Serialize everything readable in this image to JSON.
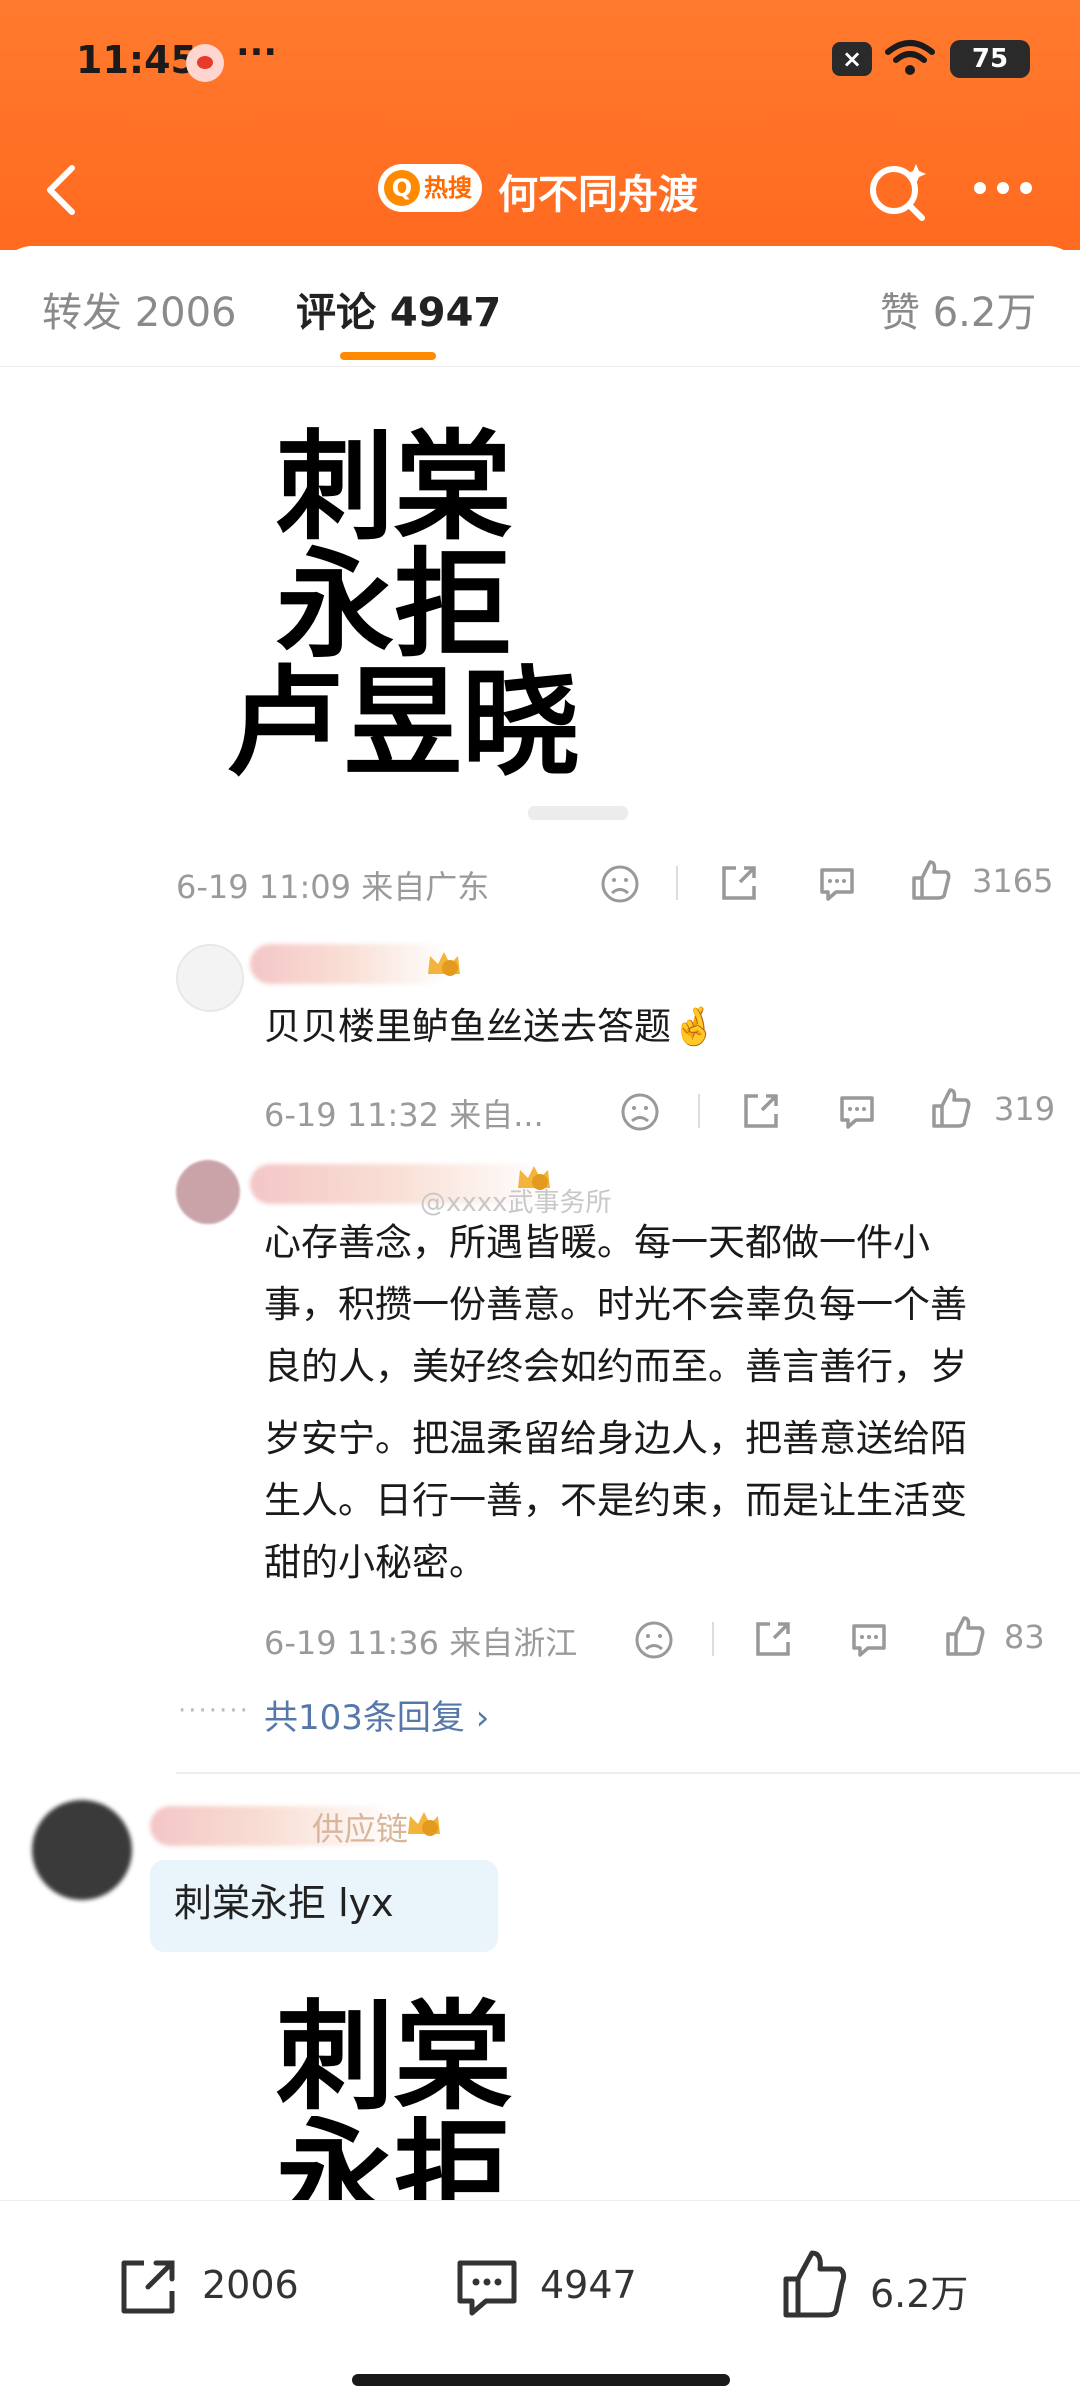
{
  "status_bar": {
    "time": "11:45",
    "dots": "···",
    "battery": "75",
    "x_label": "×"
  },
  "nav": {
    "hot_label": "热搜",
    "title": "何不同舟渡"
  },
  "tabs": [
    {
      "label": "转发 2006"
    },
    {
      "label": "评论 4947"
    },
    {
      "label": "赞 6.2万"
    }
  ],
  "post_image": {
    "line1": "刺棠",
    "line2": "永拒",
    "line3": "卢昱晓"
  },
  "post_meta": {
    "time_loc": "6-19 11:09 来自广东",
    "likes": "3165"
  },
  "comments": [
    {
      "text": "贝贝楼里鲈鱼丝送去答题🤞",
      "time_loc": "6-19 11:32 来自...",
      "likes": "319"
    },
    {
      "text_lines": [
        "心存善念，所遇皆暖。每一天都做一件小",
        "事，积攒一份善意。时光不会辜负每一个善",
        "良的人，美好终会如约而至。善言善行，岁",
        "岁安宁。把温柔留给身边人，把善意送给陌",
        "生人。日行一善，不是约束，而是让生活变",
        "甜的小秘密。"
      ],
      "time_loc": "6-19 11:36 来自浙江",
      "likes": "83"
    }
  ],
  "watermark": "@xxxx武事务所",
  "replies_link": "共103条回复 ›",
  "replies_dots": "·······",
  "second_post": {
    "name_partial": "供应链",
    "bubble": "刺棠永拒 lyx",
    "line1": "刺棠",
    "line2": "永拒"
  },
  "bottom_bar": {
    "share_count": "2006",
    "comment_count": "4947",
    "like_count": "6.2万"
  }
}
